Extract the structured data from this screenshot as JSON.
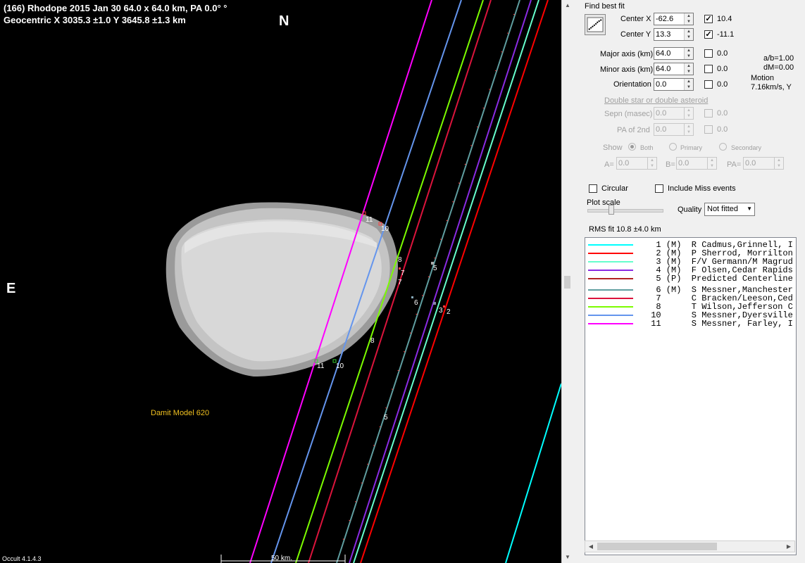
{
  "plot": {
    "title_line1": "(166) Rhodope  2015 Jan 30   64.0 x 64.0 km, PA 0.0° °",
    "title_line2": "Geocentric  X  3035.3 ±1.0  Y 3645.8 ±1.3 km",
    "north_label": "N",
    "east_label": "E",
    "model_label": "Damit Model 620",
    "scale_label": "50 km.",
    "version": "Occult 4.1.4.3",
    "chord_labels": [
      "11",
      "10",
      "8",
      "5",
      "7",
      "7",
      "6",
      "3",
      "2",
      "8",
      "11",
      "10",
      "5"
    ]
  },
  "panel": {
    "find_best_fit": "Find best fit",
    "center_x": {
      "label": "Center X",
      "value": "-62.6",
      "checked": "✓",
      "fit": "10.4"
    },
    "center_y": {
      "label": "Center Y",
      "value": "13.3",
      "checked": "✓",
      "fit": "-11.1"
    },
    "major_axis": {
      "label": "Major axis (km)",
      "value": "64.0",
      "fit": "0.0"
    },
    "minor_axis": {
      "label": "Minor axis (km)",
      "value": "64.0",
      "fit": "0.0"
    },
    "orientation": {
      "label": "Orientation",
      "value": "0.0",
      "fit": "0.0"
    },
    "ab_ratio": "a/b=1.00",
    "dm": "dM=0.00",
    "motion_label": "Motion",
    "motion_value": "7.16km/s, Y",
    "double_star_link": "Double star  or  double asteroid",
    "sepn": {
      "label": "Sepn (masec)",
      "value": "0.0",
      "fit": "0.0"
    },
    "pa2": {
      "label": "PA of 2nd",
      "value": "0.0",
      "fit": "0.0"
    },
    "show_label": "Show",
    "show_options": [
      "Both",
      "Primary",
      "Secondary"
    ],
    "a_label": "A=",
    "a_value": "0.0",
    "b_label": "B=",
    "b_value": "0.0",
    "pa_label": "PA=",
    "pa_value": "0.0",
    "circular_label": "Circular",
    "include_miss_label": "Include Miss events",
    "plot_scale_label": "Plot scale",
    "quality_label": "Quality",
    "quality_value": "Not fitted",
    "rms_fit": "RMS fit  10.8 ±4.0 km"
  },
  "observers": [
    {
      "num": "1",
      "tag": "(M)",
      "name": "R Cadmus,Grinnell, I",
      "color": "#00ffff"
    },
    {
      "num": "2",
      "tag": "(M)",
      "name": "P Sherrod, Morrilton",
      "color": "#ff0000"
    },
    {
      "num": "3",
      "tag": "(M)",
      "name": "F/V Germann/M Magrud",
      "color": "#66ffcc"
    },
    {
      "num": "4",
      "tag": "(M)",
      "name": "F Olsen,Cedar Rapids",
      "color": "#8a2be2"
    },
    {
      "num": "5",
      "tag": "(P)",
      "name": "Predicted Centerline",
      "color": "#b22222"
    },
    {
      "num": "6",
      "tag": "(M)",
      "name": "S Messner,Manchester",
      "color": "#5f9ea0"
    },
    {
      "num": "7",
      "tag": "",
      "name": "C Bracken/Leeson,Ced",
      "color": "#dc143c"
    },
    {
      "num": "8",
      "tag": "",
      "name": "T Wilson,Jefferson C",
      "color": "#7cfc00"
    },
    {
      "num": "10",
      "tag": "",
      "name": "S Messner,Dyersville",
      "color": "#6495ed"
    },
    {
      "num": "11",
      "tag": "",
      "name": "S Messner, Farley, I",
      "color": "#ff00ff"
    }
  ]
}
